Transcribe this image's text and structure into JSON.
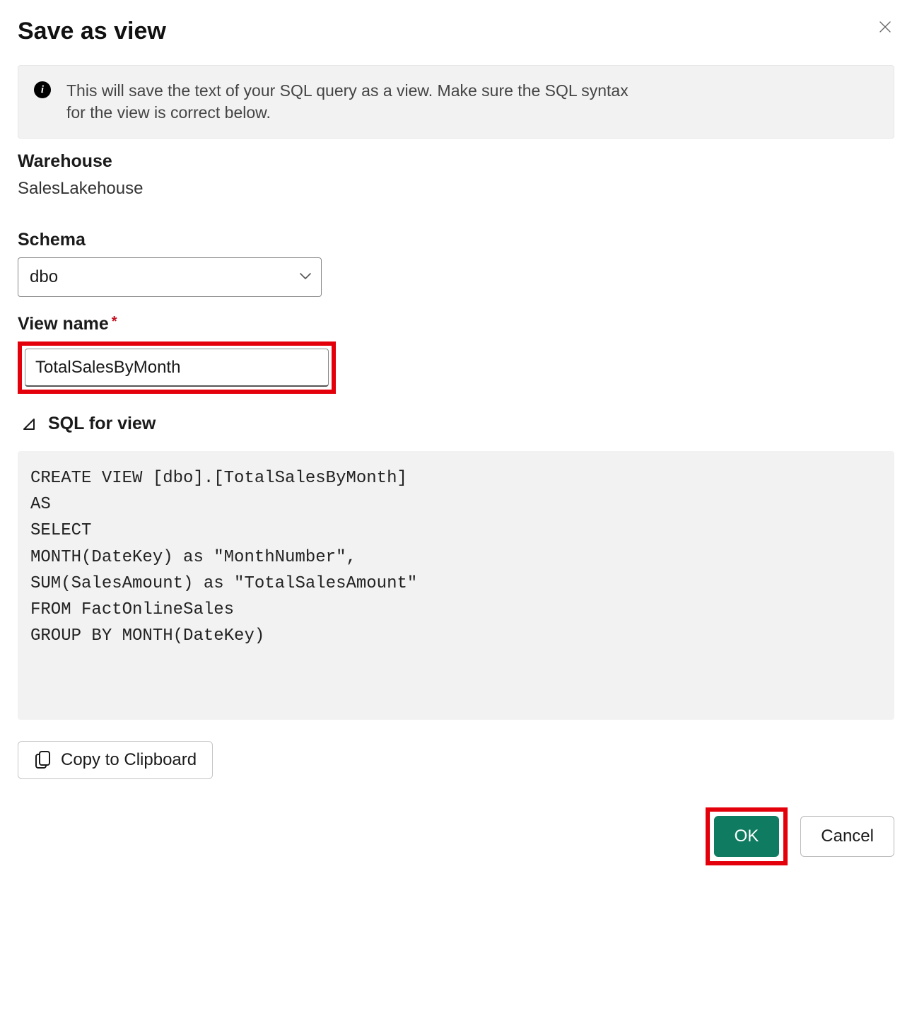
{
  "dialog": {
    "title": "Save as view",
    "info_text": "This will save the text of your SQL query as a view. Make sure the SQL syntax for the view is correct below."
  },
  "warehouse": {
    "label": "Warehouse",
    "value": "SalesLakehouse"
  },
  "schema": {
    "label": "Schema",
    "selected": "dbo"
  },
  "view_name": {
    "label": "View name",
    "value": "TotalSalesByMonth"
  },
  "sql_section": {
    "heading": "SQL for view",
    "code": "CREATE VIEW [dbo].[TotalSalesByMonth]\nAS\nSELECT\nMONTH(DateKey) as \"MonthNumber\",\nSUM(SalesAmount) as \"TotalSalesAmount\"\nFROM FactOnlineSales\nGROUP BY MONTH(DateKey)"
  },
  "buttons": {
    "copy": "Copy to Clipboard",
    "ok": "OK",
    "cancel": "Cancel"
  }
}
